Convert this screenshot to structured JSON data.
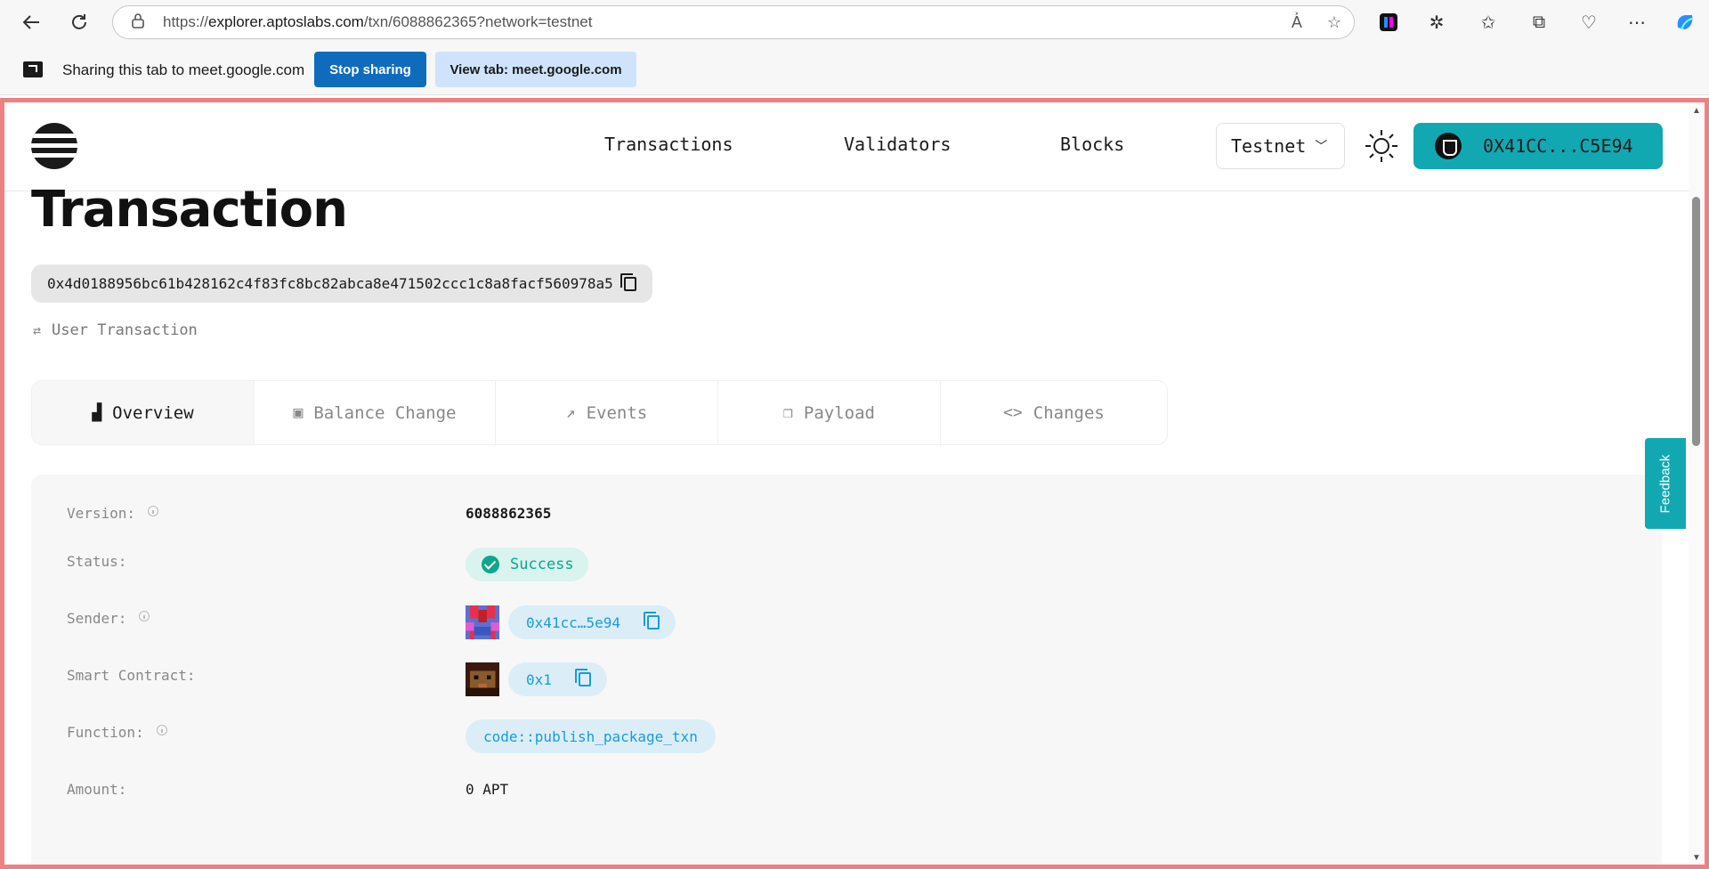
{
  "browser": {
    "url_prefix": "https://",
    "url_domain": "explorer.aptoslabs.com",
    "url_path": "/txn/6088862365?network=testnet"
  },
  "share_bar": {
    "message": "Sharing this tab to meet.google.com",
    "stop_label": "Stop sharing",
    "view_label": "View tab: meet.google.com"
  },
  "header": {
    "nav": [
      "Transactions",
      "Validators",
      "Blocks"
    ],
    "network": "Testnet",
    "wallet_address": "0X41CC...C5E94"
  },
  "feedback_label": "Feedback",
  "page": {
    "title": "Transaction",
    "hash": "0x4d0188956bc61b428162c4f83fc8bc82abca8e471502ccc1c8a8facf560978a5",
    "txn_type": "User Transaction"
  },
  "tabs": [
    {
      "label": "Overview",
      "icon": "bar-chart-icon",
      "glyph": "▟"
    },
    {
      "label": "Balance Change",
      "icon": "wallet-icon",
      "glyph": "▣"
    },
    {
      "label": "Events",
      "icon": "events-icon",
      "glyph": "↗"
    },
    {
      "label": "Payload",
      "icon": "copy-icon",
      "glyph": "❐"
    },
    {
      "label": "Changes",
      "icon": "code-icon",
      "glyph": "<>"
    }
  ],
  "overview": {
    "version_label": "Version:",
    "version": "6088862365",
    "status_label": "Status:",
    "status": "Success",
    "sender_label": "Sender:",
    "sender": "0x41cc…5e94",
    "contract_label": "Smart Contract:",
    "contract": "0x1",
    "function_label": "Function:",
    "function": "code::publish_package_txn",
    "amount_label": "Amount:",
    "amount": "0 APT"
  },
  "colors": {
    "accent": "#12a8b1",
    "success": "#0fa68e",
    "link": "#1b9bd7",
    "share_border": "#f08080"
  }
}
